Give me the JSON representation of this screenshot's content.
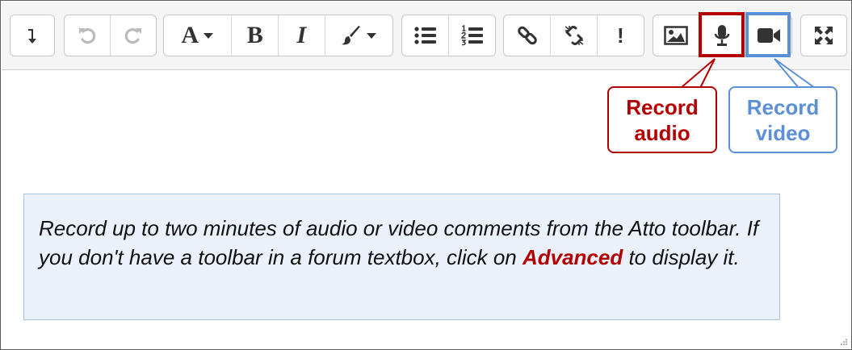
{
  "toolbar": {
    "groups": [
      [
        "show-more-buttons-icon"
      ],
      [
        "undo-icon",
        "redo-icon"
      ],
      [
        "font-style-icon",
        "bold-icon",
        "italic-icon",
        "text-color-icon"
      ],
      [
        "bullet-list-icon",
        "numbered-list-icon"
      ],
      [
        "link-icon",
        "unlink-icon",
        "emoji-icon"
      ],
      [
        "image-icon",
        "microphone-icon",
        "video-camera-icon"
      ],
      [
        "fullscreen-icon"
      ]
    ],
    "bold_glyph": "B",
    "italic_glyph": "I",
    "font_glyph": "A",
    "emoji_glyph": "!"
  },
  "callouts": {
    "audio": {
      "line1": "Record",
      "line2": "audio",
      "color": "#b30000"
    },
    "video": {
      "line1": "Record",
      "line2": "video",
      "color": "#5b8fd6"
    }
  },
  "note": {
    "before": "Record up to two minutes of audio or video comments from the Atto toolbar. If you don't have a toolbar in a forum textbox, click on ",
    "highlight": "Advanced",
    "after": " to display it."
  },
  "colors": {
    "highlight_red": "#b30000",
    "highlight_blue": "#5b8fd6",
    "note_background": "#eaf1fa"
  }
}
